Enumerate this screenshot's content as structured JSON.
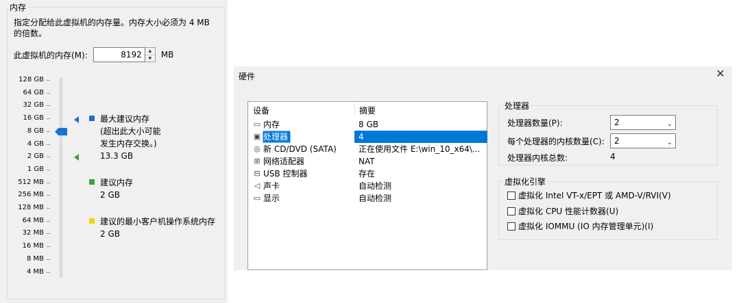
{
  "memory": {
    "group_title": "内存",
    "description": "指定分配给此虚拟机的内存量。内存大小必须为 4 MB 的倍数。",
    "field_label": "此虚拟机的内存(M):",
    "value": "8192",
    "unit": "MB",
    "scale": [
      "128 GB",
      "64 GB",
      "32 GB",
      "16 GB",
      "8 GB",
      "4 GB",
      "2 GB",
      "1 GB",
      "512 MB",
      "256 MB",
      "128 MB",
      "64 MB",
      "32 MB",
      "16 MB",
      "8 MB",
      "4 MB"
    ],
    "legend": {
      "max_title": "最大建议内存",
      "max_note": "(超出此大小可能\n发生内存交换。)",
      "max_value": "13.3 GB",
      "rec_title": "建议内存",
      "rec_value": "2 GB",
      "min_title": "建议的最小客户机操作系统内存",
      "min_value": "2 GB"
    },
    "colors": {
      "max": "#1e6fc8",
      "rec": "#3ea03a",
      "min": "#f4d400",
      "thumb": "#1874d2"
    }
  },
  "hardware": {
    "title": "硬件",
    "close_icon": "close-icon",
    "columns": {
      "device": "设备",
      "summary": "摘要"
    },
    "devices": [
      {
        "icon": "memory-icon",
        "name": "内存",
        "summary": "8 GB"
      },
      {
        "icon": "cpu-icon",
        "name": "处理器",
        "summary": "4"
      },
      {
        "icon": "cd-icon",
        "name": "新 CD/DVD (SATA)",
        "summary": "正在使用文件 E:\\win_10_x64\\..."
      },
      {
        "icon": "network-icon",
        "name": "网络适配器",
        "summary": "NAT"
      },
      {
        "icon": "usb-icon",
        "name": "USB 控制器",
        "summary": "存在"
      },
      {
        "icon": "speaker-icon",
        "name": "声卡",
        "summary": "自动检测"
      },
      {
        "icon": "monitor-icon",
        "name": "显示",
        "summary": "自动检测"
      }
    ],
    "selected_device": "处理器",
    "processor": {
      "group_title": "处理器",
      "count_label": "处理器数量(P):",
      "count_value": "2",
      "cores_label": "每个处理器的内核数量(C):",
      "cores_value": "2",
      "total_label": "处理器内核总数:",
      "total_value": "4"
    },
    "virtualization": {
      "group_title": "虚拟化引擎",
      "options": [
        {
          "label": "虚拟化 Intel VT-x/EPT 或 AMD-V/RVI(V)",
          "checked": false
        },
        {
          "label": "虚拟化 CPU 性能计数器(U)",
          "checked": false
        },
        {
          "label": "虚拟化 IOMMU (IO 内存管理单元)(I)",
          "checked": false
        }
      ]
    }
  }
}
